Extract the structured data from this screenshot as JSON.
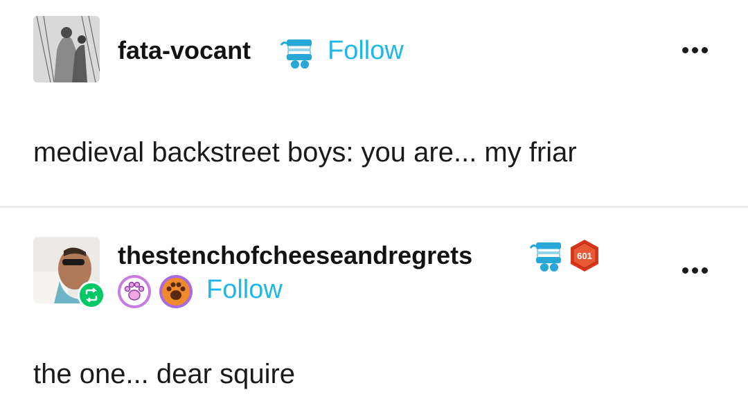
{
  "posts": [
    {
      "username": "fata-vocant",
      "follow_label": "Follow",
      "body": "medieval backstreet boys: you are... my friar"
    },
    {
      "username": "thestenchofcheeseandregrets",
      "follow_label": "Follow",
      "badge_number": "601",
      "body": "the one... dear squire"
    }
  ],
  "colors": {
    "follow": "#1eb7e6",
    "reblog": "#00c864",
    "divider": "#ececec"
  },
  "icons": [
    "chattering-teeth-badge-icon",
    "more-options-icon",
    "reblog-icon",
    "paw-badge-icon",
    "level-badge-icon"
  ]
}
